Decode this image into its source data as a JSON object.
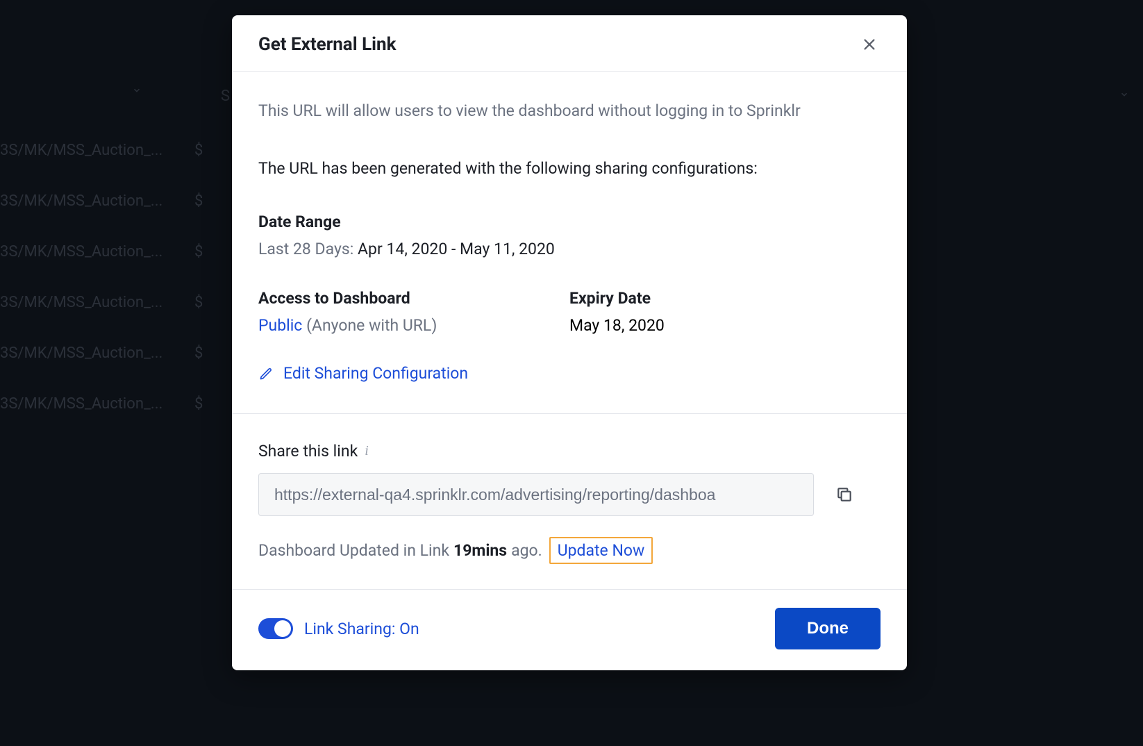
{
  "background": {
    "row_text": "3S/MK/MSS_Auction_...",
    "row_dollar": "$",
    "dropdown_s": "S"
  },
  "modal": {
    "title": "Get External Link",
    "description": "This URL will allow users to view the dashboard without logging in to Sprinklr",
    "config_intro": "The URL has been generated with the following sharing configurations:",
    "date_range": {
      "label": "Date Range",
      "prefix": "Last 28 Days:",
      "value": "Apr 14, 2020 - May 11, 2020"
    },
    "access": {
      "label": "Access to Dashboard",
      "value_link": "Public",
      "value_note": "(Anyone with URL)"
    },
    "expiry": {
      "label": "Expiry Date",
      "value": "May 18, 2020"
    },
    "edit_config": "Edit Sharing Configuration",
    "share": {
      "label": "Share this link",
      "url": "https://external-qa4.sprinklr.com/advertising/reporting/dashboa"
    },
    "updated": {
      "prefix": "Dashboard Updated in Link",
      "value": "19mins",
      "suffix": "ago.",
      "action": "Update Now"
    },
    "footer": {
      "toggle_label": "Link Sharing: On",
      "done": "Done"
    }
  }
}
